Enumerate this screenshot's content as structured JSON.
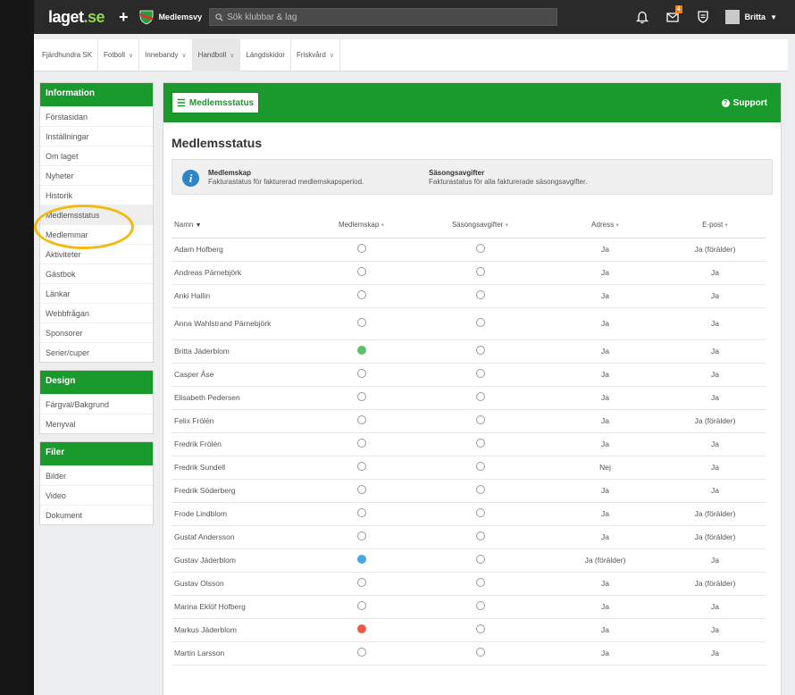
{
  "topbar": {
    "logo": "laget",
    "logo_suffix": ".se",
    "team_label": "Medlemsvy",
    "search_placeholder": "Sök klubbar & lag",
    "message_badge": "4",
    "username": "Britta",
    "icons": [
      "plus-icon",
      "team-shield-icon",
      "search-icon",
      "bell-icon",
      "messages-icon",
      "shield-icon",
      "avatar",
      "caret-down-icon"
    ]
  },
  "subnav": {
    "items": [
      {
        "label": "Fjärdhundra SK"
      },
      {
        "label": "Fotboll",
        "dropdown": true
      },
      {
        "label": "Innebandy",
        "dropdown": true
      },
      {
        "label": "Handboll",
        "dropdown": true,
        "active": true
      },
      {
        "label": "Längdskidor"
      },
      {
        "label": "Friskvård",
        "dropdown": true
      }
    ]
  },
  "sidebar": {
    "information": {
      "title": "Information",
      "items": [
        "Förstasidan",
        "Inställningar",
        "Om laget",
        "Nyheter",
        "Historik",
        "Medlemsstatus",
        "Medlemmar",
        "Aktiviteter",
        "Gästbok",
        "Länkar",
        "Webbfrågan",
        "Sponsorer",
        "Serier/cuper"
      ],
      "active": "Medlemsstatus"
    },
    "design": {
      "title": "Design",
      "items": [
        "Färgval/Bakgrund",
        "Menyval"
      ]
    },
    "files": {
      "title": "Filer",
      "items": [
        "Bilder",
        "Video",
        "Dokument"
      ]
    }
  },
  "main": {
    "menu_button": "Medlemsstatus",
    "support": "Support",
    "title": "Medlemsstatus",
    "info": {
      "membership_title": "Medlemskap",
      "membership_text": "Fakturastatus för fakturerad medlemskapsperiod.",
      "season_title": "Säsongsavgifter",
      "season_text": "Fakturastatus för alla fakturerade säsongsavgifter."
    },
    "columns": [
      "Namn",
      "Medlemskap",
      "Säsongsavgifter",
      "Adress",
      "E-post"
    ],
    "legend_colors": {
      "green": "#5ec06a",
      "blue": "#48a7e8",
      "red": "#ef5a47",
      "brand": "#1a9a2c"
    },
    "rows": [
      {
        "name": "Adam Hofberg",
        "membership": "empty",
        "season": "empty",
        "address": "Ja",
        "email": "Ja (förälder)"
      },
      {
        "name": "Andreas Pärnebjörk",
        "membership": "empty",
        "season": "empty",
        "address": "Ja",
        "email": "Ja"
      },
      {
        "name": "Anki Hallin",
        "membership": "empty",
        "season": "empty",
        "address": "Ja",
        "email": "Ja"
      },
      {
        "name": "Anna Wahlstrand Pärnebjörk",
        "membership": "empty",
        "season": "empty",
        "address": "Ja",
        "email": "Ja"
      },
      {
        "name": "Britta Jäderblom",
        "membership": "green",
        "season": "empty",
        "address": "Ja",
        "email": "Ja"
      },
      {
        "name": "Casper Åse",
        "membership": "empty",
        "season": "empty",
        "address": "Ja",
        "email": "Ja"
      },
      {
        "name": "Elisabeth Pedersen",
        "membership": "empty",
        "season": "empty",
        "address": "Ja",
        "email": "Ja"
      },
      {
        "name": "Felix Frölén",
        "membership": "empty",
        "season": "empty",
        "address": "Ja",
        "email": "Ja (förälder)"
      },
      {
        "name": "Fredrik Frölén",
        "membership": "empty",
        "season": "empty",
        "address": "Ja",
        "email": "Ja"
      },
      {
        "name": "Fredrik Sundell",
        "membership": "empty",
        "season": "empty",
        "address": "Nej",
        "email": "Ja"
      },
      {
        "name": "Fredrik Söderberg",
        "membership": "empty",
        "season": "empty",
        "address": "Ja",
        "email": "Ja"
      },
      {
        "name": "Frode Lindblom",
        "membership": "empty",
        "season": "empty",
        "address": "Ja",
        "email": "Ja (förälder)"
      },
      {
        "name": "Gustaf Andersson",
        "membership": "empty",
        "season": "empty",
        "address": "Ja",
        "email": "Ja (förälder)"
      },
      {
        "name": "Gustav Jäderblom",
        "membership": "blue",
        "season": "empty",
        "address": "Ja (förälder)",
        "email": "Ja"
      },
      {
        "name": "Gustav Olsson",
        "membership": "empty",
        "season": "empty",
        "address": "Ja",
        "email": "Ja (förälder)"
      },
      {
        "name": "Marina Eklöf Hofberg",
        "membership": "empty",
        "season": "empty",
        "address": "Ja",
        "email": "Ja"
      },
      {
        "name": "Markus Jäderblom",
        "membership": "red",
        "season": "empty",
        "address": "Ja",
        "email": "Ja"
      },
      {
        "name": "Martin Larsson",
        "membership": "empty",
        "season": "empty",
        "address": "Ja",
        "email": "Ja"
      }
    ]
  }
}
